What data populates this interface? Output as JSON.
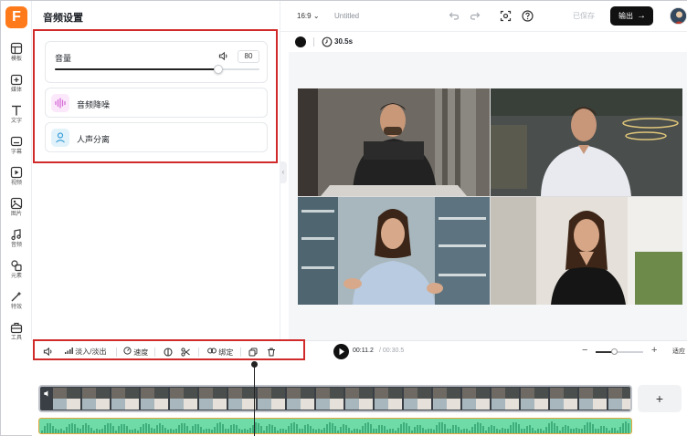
{
  "app": {
    "logo_letter": "F"
  },
  "sidebar": {
    "items": [
      {
        "label": "模板",
        "icon": "template-icon"
      },
      {
        "label": "媒体",
        "icon": "media-upload-icon"
      },
      {
        "label": "文字",
        "icon": "text-icon"
      },
      {
        "label": "字幕",
        "icon": "subtitle-icon"
      },
      {
        "label": "视频",
        "icon": "video-icon"
      },
      {
        "label": "图片",
        "icon": "image-icon"
      },
      {
        "label": "音频",
        "icon": "music-icon"
      },
      {
        "label": "元素",
        "icon": "elements-icon"
      },
      {
        "label": "特效",
        "icon": "effects-icon"
      },
      {
        "label": "工具",
        "icon": "tools-icon"
      }
    ]
  },
  "panel": {
    "title": "音频设置",
    "volume": {
      "label": "音量",
      "value": "80",
      "level_percent": 80
    },
    "options": [
      {
        "label": "音频降噪",
        "icon": "waveform-icon",
        "color": "#d86bd8"
      },
      {
        "label": "人声分离",
        "icon": "person-icon",
        "color": "#3a9fd8"
      }
    ]
  },
  "topbar": {
    "ratio": "16:9",
    "title": "Untitled",
    "saved_label": "已保存",
    "export_label": "输出"
  },
  "canvas": {
    "background_color": "#111111",
    "duration": "30.5s"
  },
  "toolbar": {
    "fade_label": "淡入/淡出",
    "speed_label": "速度",
    "bind_label": "绑定",
    "time_current": "00:11.2",
    "time_total": "/ 00:30.5",
    "zoom_level_percent": 40,
    "fit_label": "适应"
  },
  "timeline": {
    "clip_count_visible": 20,
    "add_label": "+"
  },
  "colors": {
    "accent": "#ff7a1a",
    "highlight_box": "#d12a2a",
    "audio_track": "#6fdca8",
    "audio_border": "#e7a53c"
  }
}
